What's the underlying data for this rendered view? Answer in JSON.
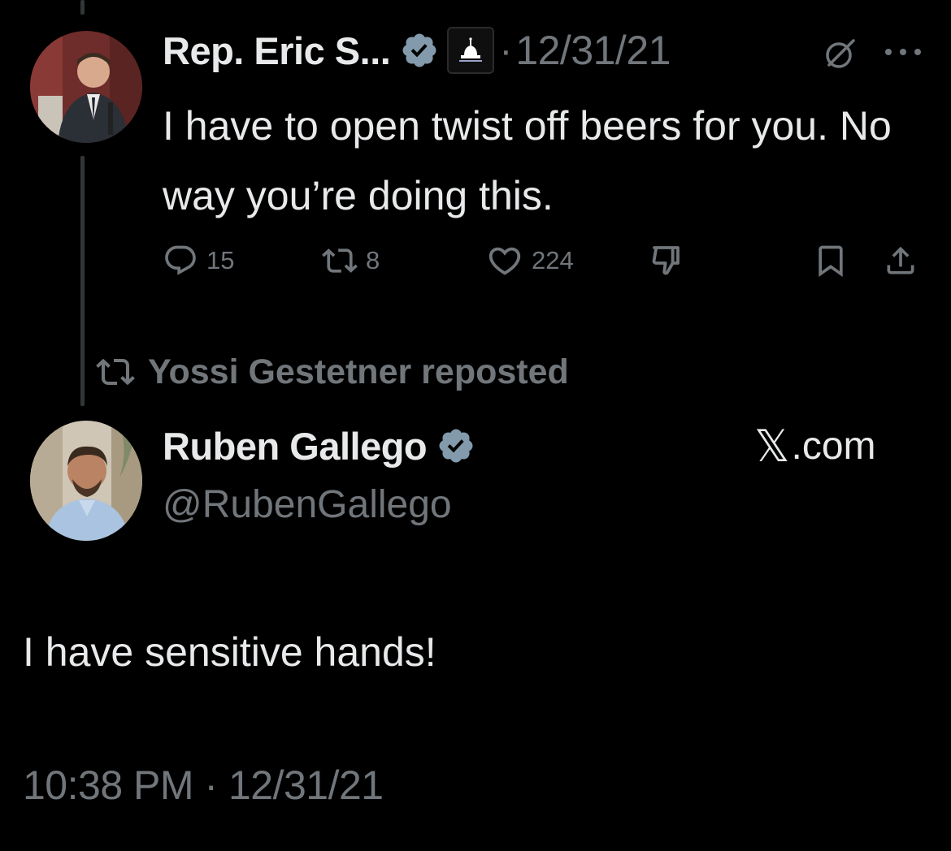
{
  "parent_tweet": {
    "author_name": "Rep. Eric S...",
    "separator": "·",
    "date": "12/31/21",
    "text": "I have to open twist off beers for you. No way you’re doing this.",
    "metrics": {
      "replies": "15",
      "reposts": "8",
      "likes": "224"
    },
    "icons": {
      "verified": "verified-badge-icon",
      "affiliation": "capitol-dome-icon",
      "grok": "grok-icon",
      "more": "more-options-icon",
      "reply": "reply-bubble-icon",
      "repost": "repost-icon",
      "like": "heart-icon",
      "dislike": "thumbs-down-icon",
      "bookmark": "bookmark-icon",
      "share": "share-icon"
    }
  },
  "repost_banner": {
    "text": "Yossi Gestetner reposted"
  },
  "main_tweet": {
    "author_name": "Ruben Gallego",
    "handle": "@RubenGallego",
    "brand_x": "𝕏",
    "brand_suffix": ".com",
    "text": "I have sensitive hands!",
    "timestamp": "10:38 PM · 12/31/21"
  },
  "colors": {
    "background": "#000000",
    "primary_text": "#e7e9ea",
    "secondary_text": "#71767b",
    "verified_badge": "#829aab",
    "thread_line": "#333639"
  }
}
